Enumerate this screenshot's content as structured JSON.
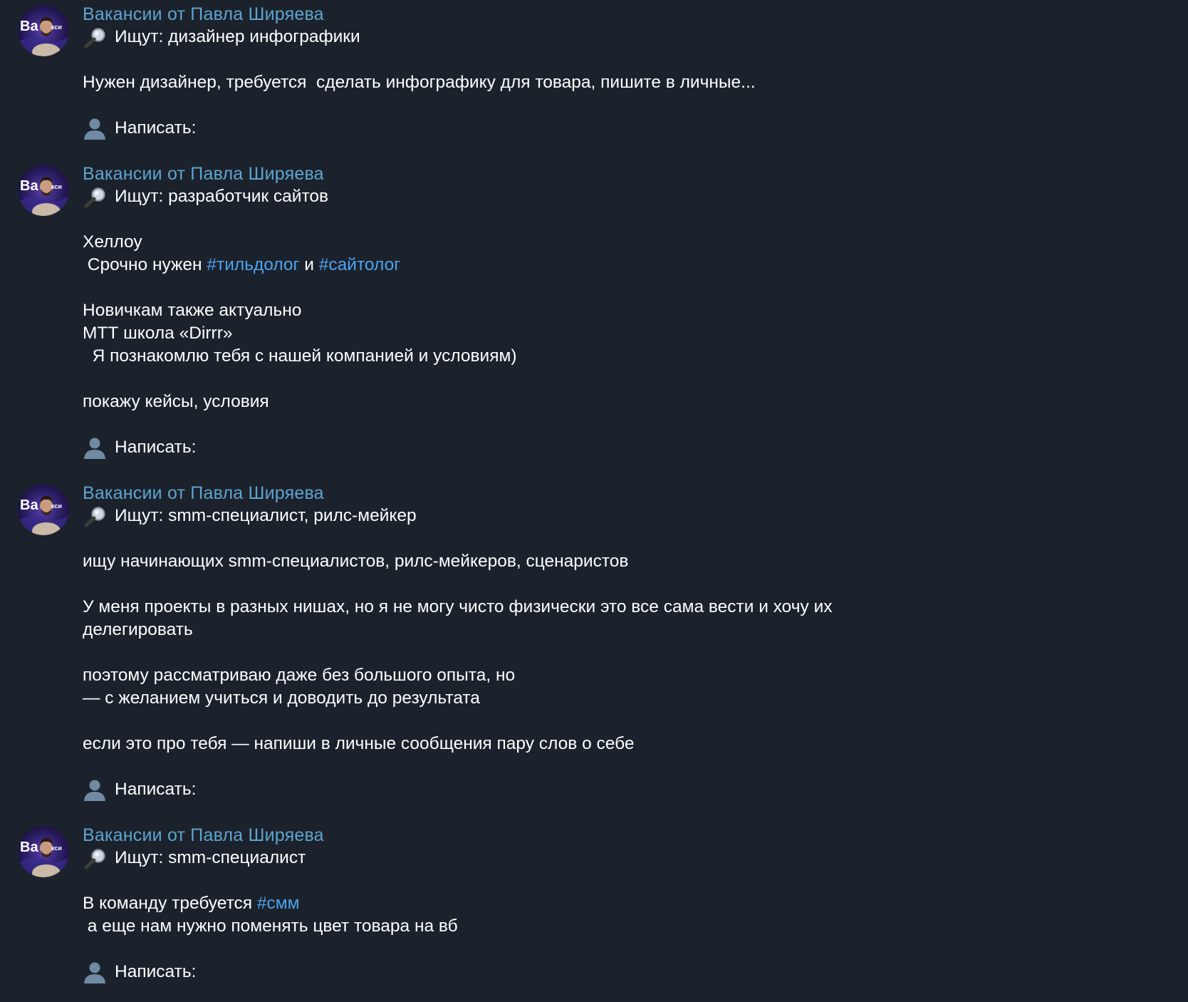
{
  "channel": {
    "name": "Вакансии от Павла Ширяева",
    "avatar_text": "Вакансии"
  },
  "messages": [
    {
      "sender": "Вакансии от Павла Ширяева",
      "search_icon": "magnifier-emoji",
      "looking_prefix": "Ищут: ",
      "looking_for": "дизайнер инфографики",
      "body": [
        "Нужен дизайнер, требуется  сделать инфографику для товара, пишите в личные..."
      ],
      "person_icon": "person-silhouette-emoji",
      "write_label": "Написать:"
    },
    {
      "sender": "Вакансии от Павла Ширяева",
      "search_icon": "magnifier-emoji",
      "looking_prefix": "Ищут: ",
      "looking_for": "разработчик сайтов",
      "body_1": "Хеллоу",
      "body_2_prefix": " Срочно нужен ",
      "hashtag_1": "#тильдолог",
      "body_2_middle": " и ",
      "hashtag_2": "#сайтолог",
      "body_3": [
        "Новичкам также актуально",
        "МТТ школа «Dirrr»",
        "  Я познакомлю тебя с нашей компанией и условиям)"
      ],
      "body_4": "покажу кейсы, условия",
      "person_icon": "person-silhouette-emoji",
      "write_label": "Написать:"
    },
    {
      "sender": "Вакансии от Павла Ширяева",
      "search_icon": "magnifier-emoji",
      "looking_prefix": "Ищут: ",
      "looking_for": "smm-специалист, рилс-мейкер",
      "paragraphs": [
        [
          "ищу начинающих smm-специалистов, рилс-мейкеров, сценаристов"
        ],
        [
          "У меня проекты в разных нишах, но я не могу чисто физически это все сама вести и хочу их",
          "делегировать"
        ],
        [
          "поэтому рассматриваю даже без большого опыта, но",
          "— с желанием учиться и доводить до результата"
        ],
        [
          "если это про тебя — напиши в личные сообщения пару слов о себе"
        ]
      ],
      "person_icon": "person-silhouette-emoji",
      "write_label": "Написать:"
    },
    {
      "sender": "Вакансии от Павла Ширяева",
      "search_icon": "magnifier-emoji",
      "looking_prefix": "Ищут: ",
      "looking_for": "smm-специалист",
      "body_1_prefix": "В команду требуется ",
      "hashtag": "#смм",
      "body_2": " а еще нам нужно поменять цвет товара на вб",
      "person_icon": "person-silhouette-emoji",
      "write_label": "Написать:"
    }
  ],
  "colors": {
    "background": "#1b222c",
    "sender_name": "#5fa4cf",
    "hashtag": "#4ea3f1",
    "text": "#ffffff"
  }
}
